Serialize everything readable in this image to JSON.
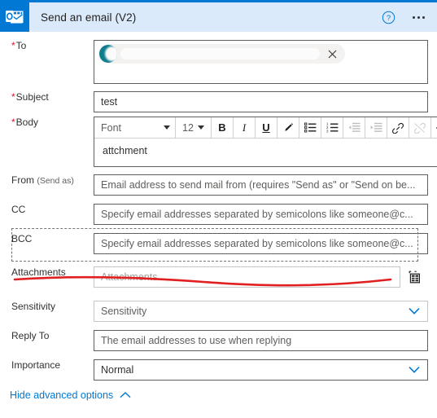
{
  "header": {
    "title": "Send an email (V2)",
    "app_icon": "outlook-icon",
    "help_icon": "help-circle-icon",
    "more_icon": "ellipsis-icon",
    "accent_color": "#0078d4",
    "background_color": "#dbeafa"
  },
  "fields": {
    "to": {
      "label": "To",
      "required": true,
      "chip": {
        "name": "",
        "avatar_color": "#0f7e8c",
        "remove_icon": "close-icon"
      }
    },
    "subject": {
      "label": "Subject",
      "required": true,
      "value": "test"
    },
    "body": {
      "label": "Body",
      "required": true,
      "value": "attchment",
      "toolbar": {
        "font_name": "Font",
        "font_size": "12",
        "buttons": [
          {
            "name": "bold-icon",
            "glyph": "B",
            "disabled": false
          },
          {
            "name": "italic-icon",
            "glyph": "I",
            "disabled": false
          },
          {
            "name": "underline-icon",
            "glyph": "U",
            "disabled": false
          },
          {
            "name": "text-color-icon",
            "glyph": "pen",
            "disabled": false
          },
          {
            "name": "bulleted-list-icon",
            "glyph": "bullets",
            "disabled": false
          },
          {
            "name": "numbered-list-icon",
            "glyph": "numbers",
            "disabled": false
          },
          {
            "name": "decrease-indent-icon",
            "glyph": "outdent",
            "disabled": true
          },
          {
            "name": "increase-indent-icon",
            "glyph": "indent",
            "disabled": true
          },
          {
            "name": "insert-link-icon",
            "glyph": "link",
            "disabled": false
          },
          {
            "name": "remove-link-icon",
            "glyph": "unlink",
            "disabled": true
          },
          {
            "name": "code-view-icon",
            "glyph": "</>",
            "disabled": false
          }
        ]
      }
    },
    "from": {
      "label": "From",
      "label_suffix": "(Send as)",
      "placeholder": "Email address to send mail from (requires \"Send as\" or \"Send on be..."
    },
    "cc": {
      "label": "CC",
      "placeholder": "Specify email addresses separated by semicolons like someone@c..."
    },
    "bcc": {
      "label": "BCC",
      "placeholder": "Specify email addresses separated by semicolons like someone@c..."
    },
    "attachments": {
      "label": "Attachments",
      "placeholder": "Attachments",
      "dynamic_content_icon": "dynamic-content-icon",
      "highlighted": true,
      "annotation_color": "#e02020"
    },
    "sensitivity": {
      "label": "Sensitivity",
      "placeholder": "Sensitivity",
      "chevron_icon": "chevron-down-icon"
    },
    "reply_to": {
      "label": "Reply To",
      "placeholder": "The email addresses to use when replying"
    },
    "importance": {
      "label": "Importance",
      "value": "Normal",
      "chevron_icon": "chevron-down-icon"
    }
  },
  "footer": {
    "link_label": "Hide advanced options",
    "chevron_icon": "chevron-up-icon",
    "link_color": "#0078d4"
  }
}
